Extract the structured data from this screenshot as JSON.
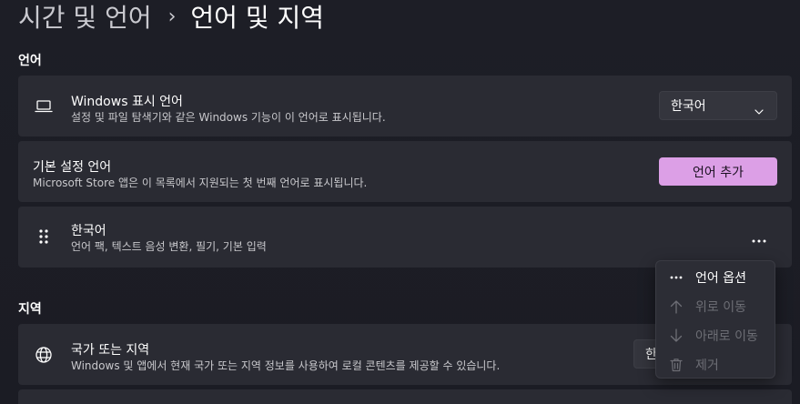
{
  "breadcrumb": {
    "parent": "시간 및 언어",
    "separator": "›",
    "current": "언어 및 지역"
  },
  "sections": {
    "language_label": "언어",
    "region_label": "지역"
  },
  "display_language": {
    "icon": "laptop-icon",
    "title": "Windows 표시 언어",
    "description": "설정 및 파일 탐색기와 같은 Windows 기능이 이 언어로 표시됩니다.",
    "selected": "한국어"
  },
  "preferred_languages": {
    "title": "기본 설정 언어",
    "description": "Microsoft Store 앱은 이 목록에서 지원되는 첫 번째 언어로 표시됩니다.",
    "add_button": "언어 추가"
  },
  "language_item": {
    "icon": "drag-handle-icon",
    "title": "한국어",
    "description": "언어 팩, 텍스트 음성 변환, 필기, 기본 입력",
    "more_icon": "more-icon"
  },
  "context_menu": {
    "items": [
      {
        "icon": "more-icon",
        "label": "언어 옵션",
        "enabled": true
      },
      {
        "icon": "arrow-up-icon",
        "label": "위로 이동",
        "enabled": false
      },
      {
        "icon": "arrow-down-icon",
        "label": "아래로 이동",
        "enabled": false
      },
      {
        "icon": "trash-icon",
        "label": "제거",
        "enabled": false
      }
    ]
  },
  "country_region": {
    "icon": "globe-icon",
    "title": "국가 또는 지역",
    "description": "Windows 및 앱에서 현재 국가 또는 지역 정보를 사용하여 로컬 콘텐츠를 제공할 수 있습니다.",
    "selected_partial": "한"
  },
  "colors": {
    "accent": "#dc9fe6",
    "card": "#2a2b33",
    "background": "#1c1d25"
  }
}
